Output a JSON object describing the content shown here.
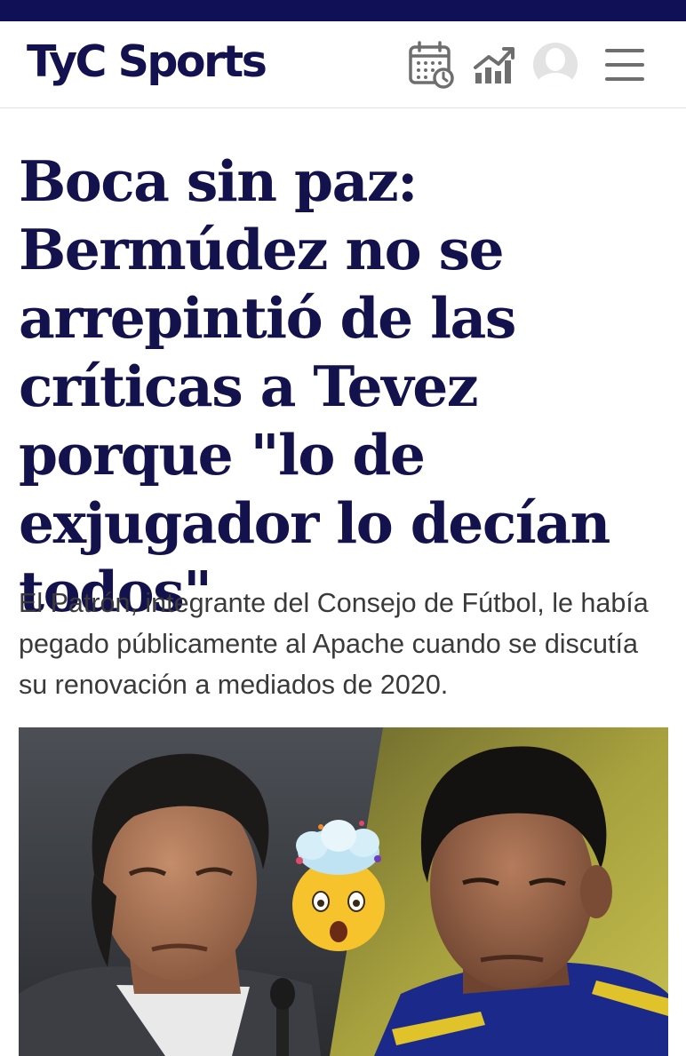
{
  "site": {
    "logo": "TyC Sports",
    "brand_color": "#0f1055",
    "header_icons": [
      "calendar-icon",
      "stats-icon",
      "user-avatar-icon",
      "menu-icon"
    ]
  },
  "article": {
    "headline": "Boca sin paz: Bermúdez no se arrepintió de las críticas a Tevez porque \"lo de exjugador lo decían todos\"",
    "summary": "El Patrón, integrante del Consejo de Fútbol, le había pegado públicamente al Apache cuando se discutía su renovación a mediados de 2020.",
    "hero_image": "Bermúdez and Tevez side by side with an exploding-head emoji between them"
  }
}
